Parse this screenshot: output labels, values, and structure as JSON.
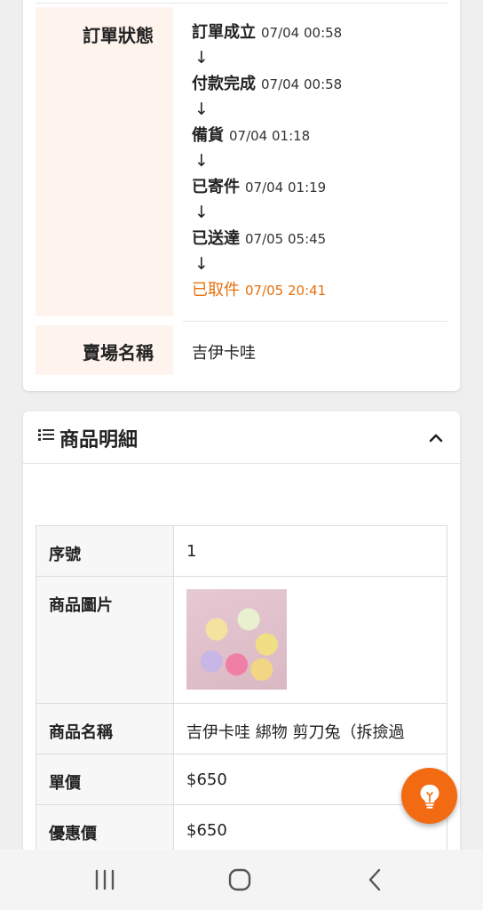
{
  "order_info": {
    "status_label": "訂單狀態",
    "steps": [
      {
        "name": "訂單成立",
        "time": "07/04 00:58"
      },
      {
        "name": "付款完成",
        "time": "07/04 00:58"
      },
      {
        "name": "備貨",
        "time": "07/04 01:18"
      },
      {
        "name": "已寄件",
        "time": "07/04 01:19"
      },
      {
        "name": "已送達",
        "time": "07/05 05:45"
      },
      {
        "name": "已取件",
        "time": "07/05 20:41"
      }
    ],
    "arrow_glyph": "↓",
    "venue_label": "賣場名稱",
    "venue_value": "吉伊卡哇"
  },
  "product_section": {
    "title": "商品明細",
    "rows": {
      "seq_label": "序號",
      "seq_value": "1",
      "image_label": "商品圖片",
      "name_label": "商品名稱",
      "name_value": "吉伊卡哇 綁物 剪刀兔（拆撿過",
      "price_label": "單價",
      "price_value": "$650",
      "discount_label": "優惠價",
      "discount_value": "$650"
    }
  },
  "colors": {
    "accent": "#e8700e",
    "fab": "#f26b13",
    "label_bg": "#fff3ee"
  },
  "icons": {
    "list": "list-icon",
    "collapse": "chevron-up-icon",
    "fab": "lightbulb-icon",
    "nav_recent": "recent-apps-icon",
    "nav_home": "home-icon",
    "nav_back": "back-icon"
  }
}
